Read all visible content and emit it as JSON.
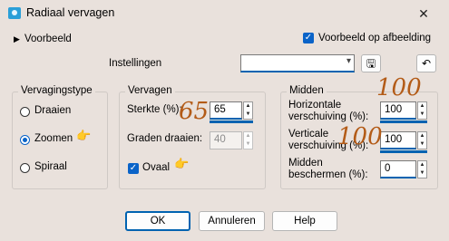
{
  "window": {
    "title": "Radiaal vervagen"
  },
  "preview": {
    "label": "Voorbeeld",
    "auto_label": "Voorbeeld op afbeelding"
  },
  "settings": {
    "label": "Instellingen",
    "value": ""
  },
  "blur_type": {
    "legend": "Vervagingstype",
    "options": [
      "Draaien",
      "Zoomen",
      "Spiraal"
    ],
    "selected": "Zoomen"
  },
  "blur": {
    "legend": "Vervagen",
    "strength_label": "Sterkte (%):",
    "strength_value": "65",
    "rotation_label": "Graden draaien:",
    "rotation_value": "40",
    "oval_label": "Ovaal",
    "oval_checked": true
  },
  "center": {
    "legend": "Midden",
    "h_offset_label_1": "Horizontale",
    "h_offset_label_2": "verschuiving (%):",
    "h_offset_value": "100",
    "v_offset_label_1": "Verticale",
    "v_offset_label_2": "verschuiving (%):",
    "v_offset_value": "100",
    "protect_label_1": "Midden",
    "protect_label_2": "beschermen (%):",
    "protect_value": "0"
  },
  "annotations": {
    "strength": "65",
    "h_offset": "100",
    "v_offset": "100"
  },
  "buttons": {
    "ok": "OK",
    "cancel": "Annuleren",
    "help": "Help"
  }
}
